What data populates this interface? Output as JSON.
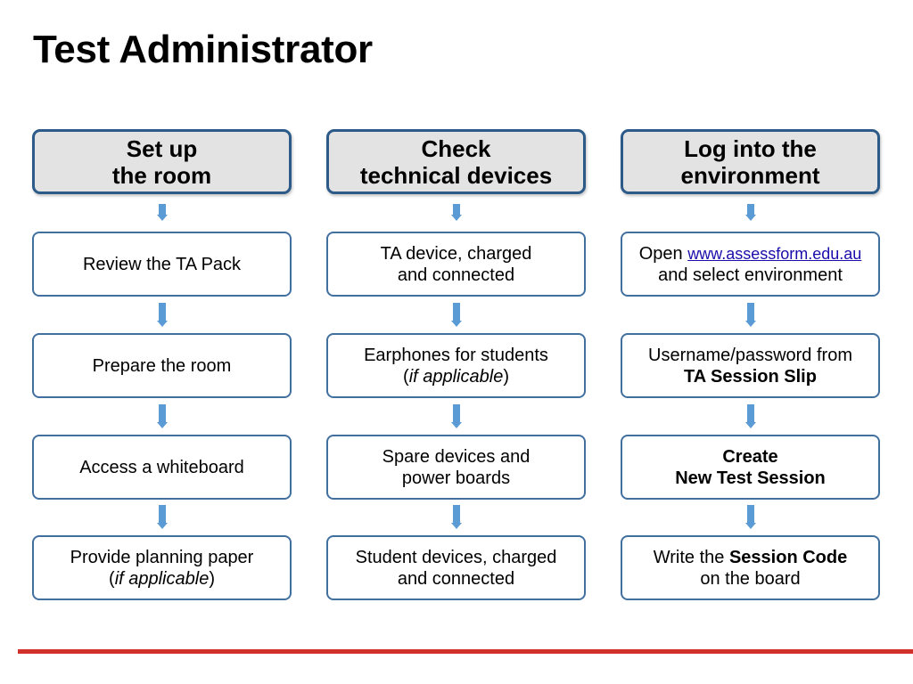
{
  "title": "Test Administrator",
  "accent_color": "#d2302a",
  "columns": [
    {
      "header": [
        "Set up",
        "the room"
      ],
      "steps": [
        {
          "lines": [
            "Review the TA Pack"
          ]
        },
        {
          "lines": [
            "Prepare the room"
          ]
        },
        {
          "lines": [
            "Access a whiteboard"
          ]
        },
        {
          "lines": [
            "Provide planning paper"
          ],
          "paren_open": "(",
          "italic": "if applicable",
          "paren_close": ")"
        }
      ]
    },
    {
      "header": [
        "Check",
        "technical devices"
      ],
      "steps": [
        {
          "lines": [
            "TA device, charged",
            "and connected"
          ]
        },
        {
          "lines": [
            "Earphones for students"
          ],
          "paren_open": "(",
          "italic": "if applicable",
          "paren_close": ")"
        },
        {
          "lines": [
            "Spare devices and",
            "power boards"
          ]
        },
        {
          "lines": [
            "Student devices, charged",
            "and connected"
          ]
        }
      ]
    },
    {
      "header": [
        "Log into the",
        "environment"
      ],
      "steps": [
        {
          "prefix": "Open ",
          "link": "www.assessform.edu.au",
          "line2": "and select environment"
        },
        {
          "line1": "Username/password from",
          "bold2": "TA Session Slip"
        },
        {
          "bold1": "Create",
          "bold2": "New Test Session"
        },
        {
          "prefix": "Write the ",
          "bold": "Session Code",
          "line2": "on the board"
        }
      ]
    }
  ],
  "arrow_icon": "down-arrow"
}
